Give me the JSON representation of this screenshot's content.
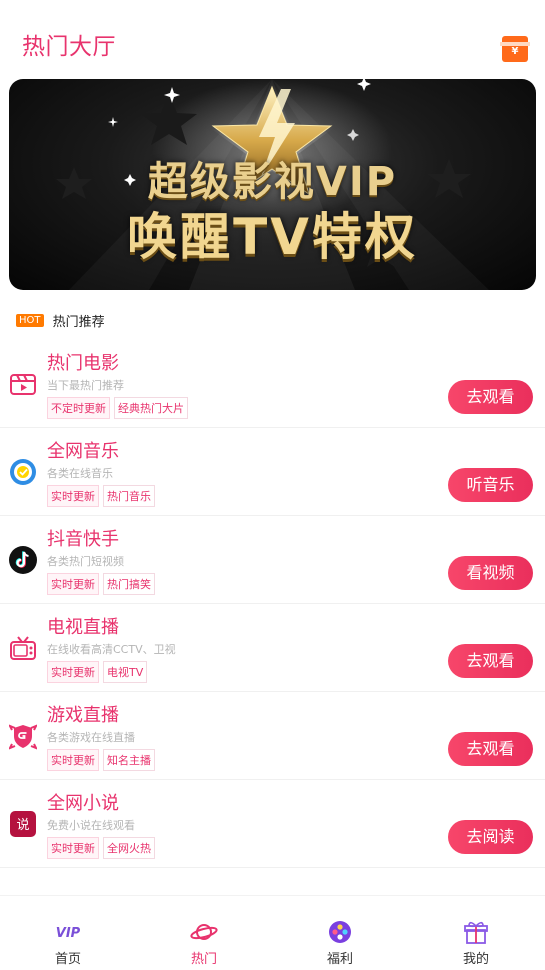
{
  "header": {
    "title": "热门大厅",
    "redpacket_symbol": "¥"
  },
  "banner": {
    "line1": "超级影视VIP",
    "line2": "唤醒TV特权"
  },
  "section": {
    "badge": "HOT",
    "title": "热门推荐"
  },
  "items": [
    {
      "title": "热门电影",
      "subtitle": "当下最热门推荐",
      "tags": [
        "不定时更新",
        "经典热门大片"
      ],
      "button": "去观看",
      "icon": "clapperboard-icon"
    },
    {
      "title": "全网音乐",
      "subtitle": "各类在线音乐",
      "tags": [
        "实时更新",
        "热门音乐"
      ],
      "button": "听音乐",
      "icon": "music-disc-icon"
    },
    {
      "title": "抖音快手",
      "subtitle": "各类热门短视频",
      "tags": [
        "实时更新",
        "热门搞笑"
      ],
      "button": "看视频",
      "icon": "tiktok-icon"
    },
    {
      "title": "电视直播",
      "subtitle": "在线收看高清CCTV、卫视",
      "tags": [
        "实时更新",
        "电视TV"
      ],
      "button": "去观看",
      "icon": "tv-icon"
    },
    {
      "title": "游戏直播",
      "subtitle": "各类游戏在线直播",
      "tags": [
        "实时更新",
        "知名主播"
      ],
      "button": "去观看",
      "icon": "game-shield-icon"
    },
    {
      "title": "全网小说",
      "subtitle": "免费小说在线观看",
      "tags": [
        "实时更新",
        "全网火热"
      ],
      "button": "去阅读",
      "icon": "novel-icon",
      "icon_text": "说"
    }
  ],
  "nav": [
    {
      "label": "首页",
      "icon": "vip-icon",
      "icon_text": "VIP"
    },
    {
      "label": "热门",
      "icon": "planet-icon",
      "active": true
    },
    {
      "label": "福利",
      "icon": "film-reel-icon"
    },
    {
      "label": "我的",
      "icon": "gift-icon"
    }
  ],
  "colors": {
    "accent": "#e8336d",
    "button": "#f03a62",
    "hot": "#ff7a00"
  }
}
